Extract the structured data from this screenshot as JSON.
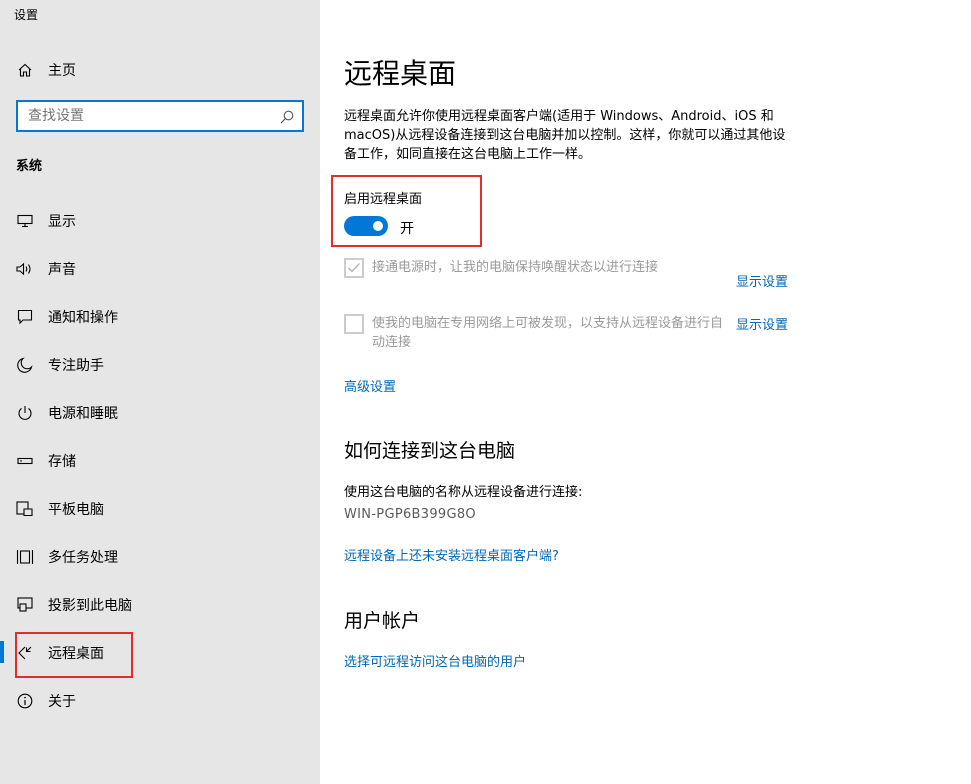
{
  "app": {
    "title": "设置"
  },
  "sidebar": {
    "home_label": "主页",
    "search_placeholder": "查找设置",
    "section": "系统",
    "items": [
      {
        "label": "显示",
        "icon": "monitor-icon"
      },
      {
        "label": "声音",
        "icon": "speaker-icon"
      },
      {
        "label": "通知和操作",
        "icon": "message-icon"
      },
      {
        "label": "专注助手",
        "icon": "moon-icon"
      },
      {
        "label": "电源和睡眠",
        "icon": "power-icon"
      },
      {
        "label": "存储",
        "icon": "storage-icon"
      },
      {
        "label": "平板电脑",
        "icon": "tablet-icon"
      },
      {
        "label": "多任务处理",
        "icon": "multitask-icon"
      },
      {
        "label": "投影到此电脑",
        "icon": "project-icon"
      },
      {
        "label": "远程桌面",
        "icon": "remote-desktop-icon",
        "active": true
      },
      {
        "label": "关于",
        "icon": "info-icon"
      }
    ]
  },
  "main": {
    "title": "远程桌面",
    "description": "远程桌面允许你使用远程桌面客户端(适用于 Windows、Android、iOS 和 macOS)从远程设备连接到这台电脑并加以控制。这样，你就可以通过其他设备工作，如同直接在这台电脑上工作一样。",
    "enable_label": "启用远程桌面",
    "toggle_state": "开",
    "toggle_on": true,
    "options": [
      {
        "text": "接通电源时，让我的电脑保持唤醒状态以进行连接",
        "checked": true,
        "link": "显示设置"
      },
      {
        "text": "使我的电脑在专用网络上可被发现，以支持从远程设备进行自动连接",
        "checked": false,
        "link": "显示设置"
      }
    ],
    "advanced_link": "高级设置",
    "connect_heading": "如何连接到这台电脑",
    "connect_desc": "使用这台电脑的名称从远程设备进行连接:",
    "pc_name": "WIN-PGP6B399G8O",
    "client_link": "远程设备上还未安装远程桌面客户端?",
    "accounts_heading": "用户帐户",
    "accounts_link": "选择可远程访问这台电脑的用户"
  },
  "colors": {
    "accent": "#0078d7",
    "link": "#0067b8",
    "highlight": "#e02d2d",
    "sidebar_bg": "#e6e6e6"
  }
}
